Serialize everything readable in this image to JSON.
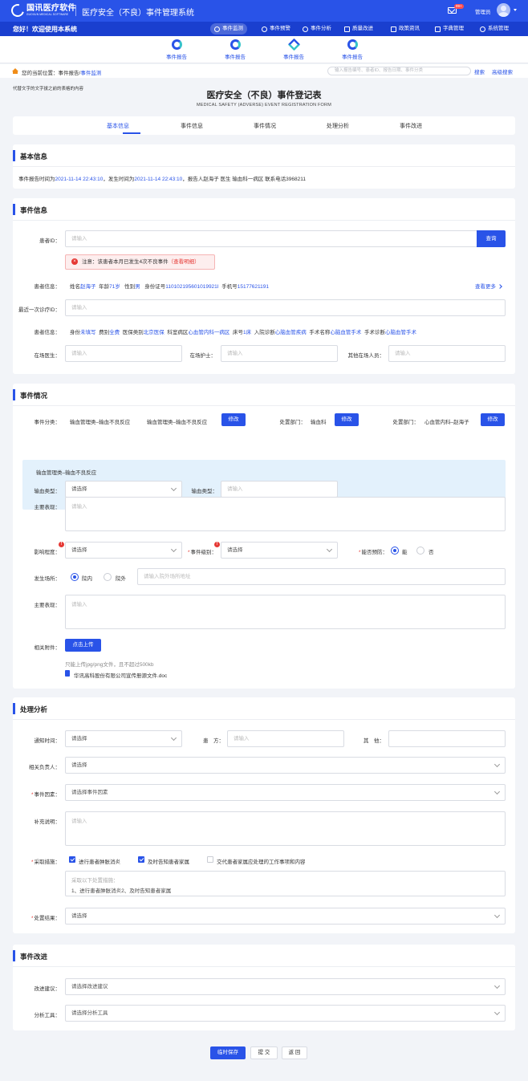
{
  "header": {
    "logo_cn": "国讯医疗软件",
    "logo_en": "GUOXUN MEDICAL SOFTWARE",
    "system_title": "医疗安全（不良）事件管理系统",
    "mail_badge": "99+",
    "user_name": "管理员"
  },
  "nav": {
    "welcome": "您好！欢迎使用本系统",
    "items": [
      {
        "label": "事件监测",
        "icon": "monitor-icon"
      },
      {
        "label": "事件预警",
        "icon": "warning-icon"
      },
      {
        "label": "事件分析",
        "icon": "analysis-icon"
      },
      {
        "label": "质量改进",
        "icon": "quality-icon"
      },
      {
        "label": "政策资讯",
        "icon": "news-icon"
      },
      {
        "label": "字典管理",
        "icon": "dictionary-icon"
      },
      {
        "label": "系统管理",
        "icon": "gear-icon"
      }
    ]
  },
  "subnav": {
    "items": [
      "事件报告",
      "事件报告",
      "事件报告",
      "事件报告"
    ]
  },
  "breadcrumb": {
    "prefix": "您的当前位置：",
    "parent": "事件报告",
    "sep": "/",
    "current": "事件监测"
  },
  "search": {
    "placeholder": "输入报告编号、患者ID、报告日期、事件分类",
    "search_label": "搜索",
    "advanced_label": "高级搜索"
  },
  "placeholder_note": "代替文字的文字拔之前的表格的内容",
  "form": {
    "title": "医疗安全（不良）事件登记表",
    "subtitle": "MEDICAL SAFETY (ADVERSE) EVENT REGISTRATION FORM"
  },
  "tabs": [
    "基本信息",
    "事件信息",
    "事件情况",
    "处理分析",
    "事件改进"
  ],
  "basic": {
    "title": "基本信息",
    "t1": "事件报告时间为",
    "report_time": "2021-11-14  22:43:10",
    "t2": "，发生时间为",
    "occur_time": "2021-11-14  22:43:10",
    "t3": "，报告人赵海子  医生  输血科一病区  联系电话3968211"
  },
  "event_info": {
    "title": "事件信息",
    "patient_id_label": "患者ID：",
    "patient_id_placeholder": "请输入",
    "query_label": "查询",
    "alert_text": "注意：该患者本月已发生4次不良事件",
    "alert_link": "（查看明细）",
    "info_label": "患者信息：",
    "name_k": "姓名",
    "name_v": "赵海子",
    "age_k": "年龄",
    "age_v": "71岁",
    "sex_k": "性别",
    "sex_v": "男",
    "idno_k": "身份证号",
    "idno_v": "110102195601019921I",
    "phone_k": "手机号",
    "phone_v": "15177621191",
    "more_label": "查看更多",
    "last_visit_label": "最近一次诊疗ID：",
    "last_visit_placeholder": "请输入",
    "info2_label": "患者信息：",
    "i2": [
      {
        "k": "身份",
        "v": "未填写"
      },
      {
        "k": "费别",
        "v": "全费"
      },
      {
        "k": "医保类别",
        "v": "北京医保"
      },
      {
        "k": "科室病区",
        "v": "心血管内科一病区"
      },
      {
        "k": "床号",
        "v": "1床"
      },
      {
        "k": "入院诊断",
        "v": "心脑血管疾病"
      },
      {
        "k": "手术名称",
        "v": "心脑血管手术"
      },
      {
        "k": "手术诊断",
        "v": "心脑血管手术"
      }
    ],
    "doctor_label": "在场医生：",
    "doctor_placeholder": "请输入",
    "nurse_label": "在场护士：",
    "nurse_placeholder": "请输入",
    "others_label": "其他在场人员：",
    "others_placeholder": "请输入"
  },
  "event_situation": {
    "title": "事件情况",
    "category_label": "事件分类：",
    "category_v1": "输血管理类–输血不良反应",
    "category_v2": "输血管理类–输血不良反应",
    "modify_label": "修改",
    "dept_label": "处置部门：",
    "dept_value": "输血科",
    "dept2_label": "处置部门：",
    "dept2_value": "心血管内科–赵海子",
    "panel_title": "输血管理类–输血不良反应",
    "blood_type_label": "输血类型：",
    "blood_type_value": "请选择",
    "blood_type2_label": "输血类型：",
    "blood_type2_placeholder": "请输入",
    "symptom_label": "主要表现：",
    "symptom_placeholder": "请输入",
    "impact_label": "影响程度：",
    "impact_value": "请选择",
    "level_label": "事件级别：",
    "level_value": "请选择",
    "prevent_label": "能否预防：",
    "prevent_yes": "能",
    "prevent_no": "否",
    "location_label": "发生场所：",
    "location_in": "院内",
    "location_out": "院外",
    "location_placeholder": "请输入院外场所地址",
    "symptom2_label": "主要表现：",
    "symptom2_placeholder": "请输入",
    "attach_label": "相关附件：",
    "upload_label": "点击上传",
    "upload_hint": "只能上传jpg/png文件，且不超过500kb",
    "file_name": "华讯高科股份有限公司宣传册源文件.doc"
  },
  "handling": {
    "title": "处理分析",
    "notify_label": "通知时间：",
    "notify_value": "请选择",
    "patient_label": "患　方：",
    "patient_placeholder": "请输入",
    "other_label": "其　他：",
    "owner_label": "相关负责人：",
    "owner_value": "请选择",
    "factor_label": "事件因素：",
    "factor_value": "请选择事件因素",
    "note_label": "补充说明：",
    "note_placeholder": "请输入",
    "measure_label": "采取措施：",
    "measure_opts": [
      "进行患者肿胀消炎",
      "及时告知患者家属",
      "交代患者家属应处理的工作事项和内容"
    ],
    "measure_text1": "采取以下处置措施：",
    "measure_text2": "1、进行患者肿胀消炎2、及时告知患者家属",
    "result_label": "处置结果：",
    "result_value": "请选择"
  },
  "improve": {
    "title": "事件改进",
    "suggest_label": "改进建议：",
    "suggest_value": "请选择改进建议",
    "tool_label": "分析工具：",
    "tool_value": "请选择分析工具"
  },
  "footer": {
    "save_label": "临时保存",
    "submit_label": "提 交",
    "back_label": "返 回"
  },
  "colors": {
    "primary": "#2953e8",
    "danger": "#e53935",
    "panel": "#e3f1fc"
  }
}
